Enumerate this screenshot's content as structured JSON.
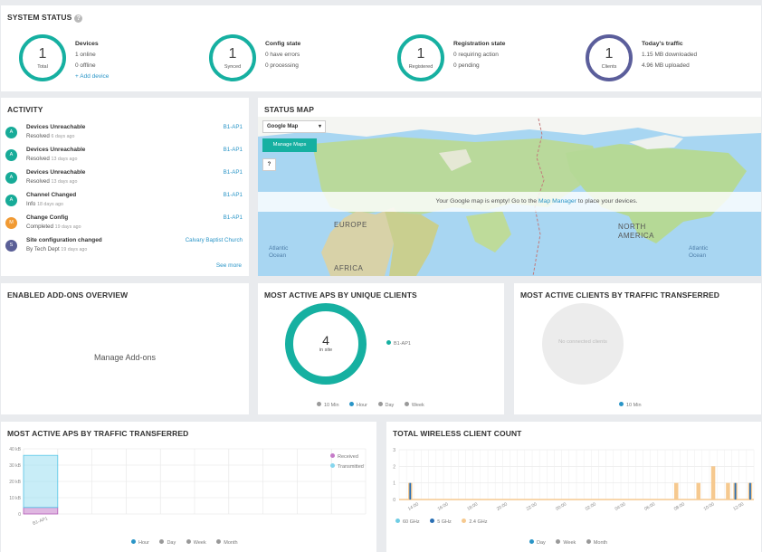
{
  "system_status": {
    "title": "SYSTEM STATUS",
    "help": "?",
    "cards": [
      {
        "ring_value": "1",
        "ring_label": "Total",
        "title": "Devices",
        "line1": "1 online",
        "line2": "0 offline",
        "link": "+ Add device"
      },
      {
        "ring_value": "1",
        "ring_label": "Synced",
        "title": "Config state",
        "line1": "0 have errors",
        "line2": "0 processing"
      },
      {
        "ring_value": "1",
        "ring_label": "Registered",
        "title": "Registration state",
        "line1": "0 requiring action",
        "line2": "0 pending"
      },
      {
        "ring_value": "1",
        "ring_label": "Clients",
        "title": "Today's traffic",
        "line1": "1.15 MB downloaded",
        "line2": "4.96 MB uploaded"
      }
    ]
  },
  "activity": {
    "title": "ACTIVITY",
    "items": [
      {
        "badge": "A",
        "title": "Devices Unreachable",
        "status": "Resolved",
        "age": "6 days ago",
        "target": "B1-AP1"
      },
      {
        "badge": "A",
        "title": "Devices Unreachable",
        "status": "Resolved",
        "age": "13 days ago",
        "target": "B1-AP1"
      },
      {
        "badge": "A",
        "title": "Devices Unreachable",
        "status": "Resolved",
        "age": "13 days ago",
        "target": "B1-AP1"
      },
      {
        "badge": "A",
        "title": "Channel Changed",
        "status": "Info",
        "age": "18 days ago",
        "target": "B1-AP1"
      },
      {
        "badge": "M",
        "title": "Change Config",
        "status": "Completed",
        "age": "19 days ago",
        "target": "B1-AP1"
      },
      {
        "badge": "S",
        "title": "Site configuration changed",
        "status": "By Tech Dept",
        "age": "19 days ago",
        "target": "Calvary Baptist Church"
      }
    ],
    "see_more": "See more"
  },
  "status_map": {
    "title": "STATUS MAP",
    "map_select": "Google Map",
    "manage_button": "Manage Maps",
    "help": "?",
    "empty_prefix": "Your Google map is empty! Go to the ",
    "empty_link": "Map Manager",
    "empty_suffix": " to place your devices.",
    "labels": [
      "EUROPE",
      "NORTH AMERICA",
      "Atlantic Ocean",
      "Atlantic Ocean",
      "AFRICA"
    ]
  },
  "addons": {
    "title": "ENABLED ADD-ONS OVERVIEW",
    "link": "Manage Add-ons"
  },
  "aps_unique": {
    "title": "MOST ACTIVE APS BY UNIQUE CLIENTS",
    "center_value": "4",
    "center_label": "in site",
    "legend": "B1-AP1",
    "ranges": [
      "10 Min",
      "Hour",
      "Day",
      "Week"
    ]
  },
  "clients_traffic": {
    "title": "MOST ACTIVE CLIENTS BY TRAFFIC TRANSFERRED",
    "empty": "No connected clients",
    "ranges": [
      "10 Min"
    ]
  },
  "aps_traffic": {
    "title": "MOST ACTIVE APS BY TRAFFIC TRANSFERRED",
    "ranges": [
      "Hour",
      "Day",
      "Week",
      "Month"
    ]
  },
  "wireless": {
    "title": "TOTAL WIRELESS CLIENT COUNT",
    "ranges": [
      "Day",
      "Week",
      "Month"
    ]
  },
  "colors": {
    "teal": "#16b0a1",
    "purple": "#5b5e9b",
    "orange": "#f19a33",
    "link": "#2a95c7",
    "received": "#c57bc8",
    "transmitted": "#86d6ee",
    "ghz5": "#2a6fb4",
    "ghz24": "#f6c98f",
    "ghz60": "#6fcde4"
  },
  "chart_data": [
    {
      "type": "bar",
      "categories": [
        "B1-AP1"
      ],
      "series": [
        {
          "name": "Received",
          "values": [
            4
          ]
        },
        {
          "name": "Transmitted",
          "values": [
            32
          ]
        }
      ],
      "ylabel": "",
      "yticks": [
        "0",
        "10 kB",
        "20 kB",
        "30 kB",
        "40 kB"
      ],
      "ylim": [
        0,
        40
      ],
      "stacked": true,
      "legend": "top-right"
    },
    {
      "type": "bar",
      "x": [
        "14:00",
        "16:00",
        "18:00",
        "20:00",
        "22:00",
        "00:00",
        "02:00",
        "04:00",
        "06:00",
        "08:00",
        "10:00",
        "12:00"
      ],
      "categories": [
        "13:00",
        "13:30",
        "14:00",
        "14:30",
        "15:00",
        "15:30",
        "16:00",
        "16:30",
        "17:00",
        "17:30",
        "18:00",
        "18:30",
        "19:00",
        "19:30",
        "20:00",
        "20:30",
        "21:00",
        "21:30",
        "22:00",
        "22:30",
        "23:00",
        "23:30",
        "00:00",
        "00:30",
        "01:00",
        "01:30",
        "02:00",
        "02:30",
        "03:00",
        "03:30",
        "04:00",
        "04:30",
        "05:00",
        "05:30",
        "06:00",
        "06:30",
        "07:00",
        "07:30",
        "08:00",
        "08:30",
        "09:00",
        "09:30",
        "10:00",
        "10:30",
        "11:00",
        "11:30",
        "12:00",
        "12:30",
        "13:00"
      ],
      "series": [
        {
          "name": "60 GHz",
          "values": [
            0,
            0,
            0,
            0,
            0,
            0,
            0,
            0,
            0,
            0,
            0,
            0,
            0,
            0,
            0,
            0,
            0,
            0,
            0,
            0,
            0,
            0,
            0,
            0,
            0,
            0,
            0,
            0,
            0,
            0,
            0,
            0,
            0,
            0,
            0,
            0,
            0,
            0,
            0,
            0,
            0,
            0,
            0,
            0,
            0,
            0,
            0,
            0,
            0
          ]
        },
        {
          "name": "5 GHz",
          "values": [
            0,
            1,
            0,
            0,
            0,
            0,
            0,
            0,
            0,
            0,
            0,
            0,
            0,
            0,
            0,
            0,
            0,
            0,
            0,
            0,
            0,
            0,
            0,
            0,
            0,
            0,
            0,
            0,
            0,
            0,
            0,
            0,
            0,
            0,
            0,
            0,
            0,
            0,
            0,
            0,
            0,
            0,
            0,
            0,
            0,
            1,
            0,
            1,
            0
          ]
        },
        {
          "name": "2.4 GHz",
          "values": [
            0,
            1,
            0,
            0,
            0,
            0,
            0,
            0,
            0,
            0,
            0,
            0,
            0,
            0,
            0,
            0,
            0,
            0,
            0,
            0,
            0,
            0,
            0,
            0,
            0,
            0,
            0,
            0,
            0,
            0,
            0,
            0,
            0,
            0,
            0,
            0,
            0,
            1,
            0,
            0,
            1,
            0,
            2,
            0,
            1,
            1,
            0,
            1,
            0
          ]
        }
      ],
      "yticks": [
        "0",
        "1",
        "2",
        "3"
      ],
      "ylim": [
        0,
        3
      ],
      "stacked": true,
      "legend": "bottom"
    }
  ]
}
